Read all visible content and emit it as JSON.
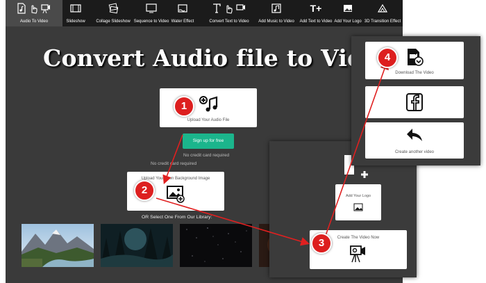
{
  "nav": {
    "items": [
      {
        "label": "Audio To Video",
        "active": true
      },
      {
        "label": "Slideshow"
      },
      {
        "label": "Collage Slideshow"
      },
      {
        "label": "Sequence to Video"
      },
      {
        "label": "Water Effect"
      },
      {
        "label": "Convert Text to Video"
      },
      {
        "label": "Add Music to Video"
      },
      {
        "label": "Add Text to Video"
      },
      {
        "label": "Add Your Logo"
      },
      {
        "label": "3D Transition Effect"
      }
    ]
  },
  "hero": {
    "title": "Convert Audio file to Video"
  },
  "upload_audio": {
    "label": "Upload Your Audio File"
  },
  "signup": {
    "label": "Sign up for free",
    "note": "No credit card required"
  },
  "no_card_note": "No credit card required",
  "upload_bg": {
    "label": "Upload Your Own Background Image"
  },
  "library_label": "OR Select One From Our Library:",
  "add_logo": {
    "label": "Add Your Logo"
  },
  "create_video": {
    "label": "Create The Video Now"
  },
  "download": {
    "label": "Download The Video"
  },
  "create_another": {
    "label": "Create another video"
  },
  "steps": {
    "s1": "1",
    "s2": "2",
    "s3": "3",
    "s4": "4"
  },
  "colors": {
    "accent_green": "#1bb58c",
    "step_red": "#dd1f1f",
    "nav_bg": "#1b1b1b",
    "page_bg": "#3a3a3a"
  }
}
